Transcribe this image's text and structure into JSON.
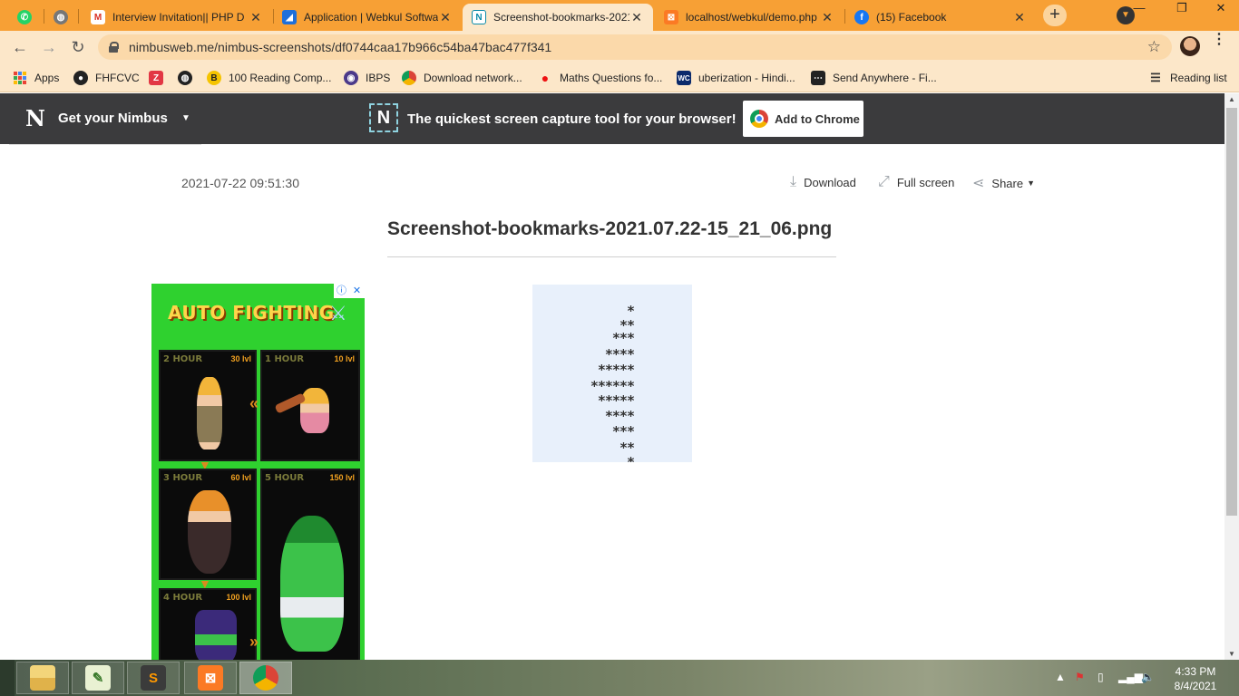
{
  "browser": {
    "tabs": [
      {
        "title": "",
        "kind": "whatsapp",
        "pinned": true
      },
      {
        "title": "",
        "kind": "globe",
        "pinned": true
      },
      {
        "title": "Interview Invitation|| PHP D",
        "kind": "gmail"
      },
      {
        "title": "Application | Webkul Softwa",
        "kind": "webkul"
      },
      {
        "title": "Screenshot-bookmarks-2021",
        "kind": "nimbus",
        "active": true
      },
      {
        "title": "localhost/webkul/demo.php",
        "kind": "xampp"
      },
      {
        "title": "(15) Facebook",
        "kind": "facebook"
      }
    ],
    "url": "nimbusweb.me/nimbus-screenshots/df0744caa17b966c54ba47bac477f341",
    "bookmarks": [
      "Apps",
      "FHFCVC",
      "",
      "",
      "100 Reading Comp...",
      "IBPS",
      "Download network...",
      "Maths Questions fo...",
      "uberization - Hindi...",
      "Send Anywhere - Fi..."
    ],
    "reading_list": "Reading list",
    "colors": {
      "frame": "#f7a035",
      "toolbar": "#fce7c9"
    }
  },
  "nimbus": {
    "brand_label": "Get your Nimbus",
    "promo_text": "The quickest screen capture tool for your browser!",
    "cta_label": "Add to Chrome",
    "timestamp": "2021-07-22 09:51:30",
    "actions": {
      "download": "Download",
      "fullscreen": "Full screen",
      "share": "Share"
    },
    "file_title": "Screenshot-bookmarks-2021.07.22-15_21_06.png",
    "preview_rows": [
      "*",
      "**",
      "***",
      "****",
      "*****",
      "******",
      "*****",
      "****",
      "***",
      "**",
      "*"
    ]
  },
  "ad": {
    "title": "AUTO FIGHTING",
    "cards": [
      {
        "label": "2 HOUR",
        "level": "30 lvl"
      },
      {
        "label": "1 HOUR",
        "level": "10 lvl"
      },
      {
        "label": "3 HOUR",
        "level": "60 lvl"
      },
      {
        "label": "5 HOUR",
        "level": "150 lvl"
      },
      {
        "label": "4 HOUR",
        "level": "100 lvl"
      }
    ]
  },
  "taskbar": {
    "clock_time": "4:33 PM",
    "clock_date": "8/4/2021"
  }
}
